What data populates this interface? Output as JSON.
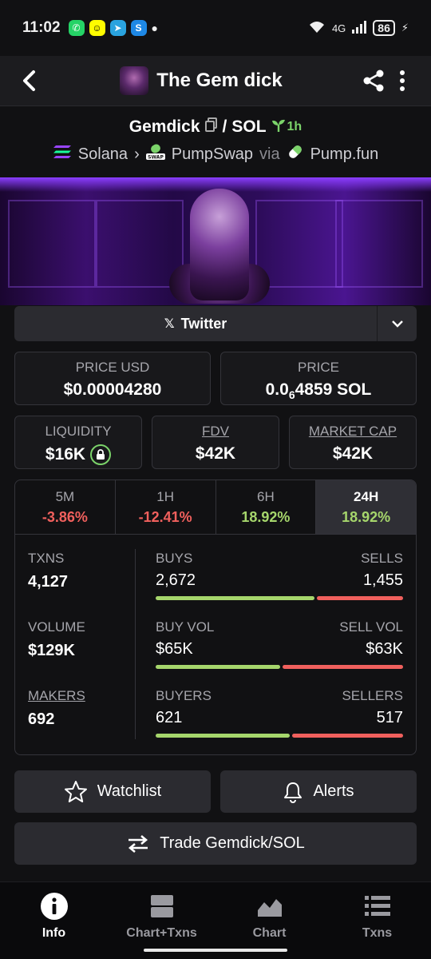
{
  "status_bar": {
    "time": "11:02",
    "network": "4G",
    "battery": "86"
  },
  "header": {
    "title": "The Gem dick"
  },
  "pair": {
    "base": "Gemdick",
    "separator": "/",
    "quote": "SOL",
    "age": "1h",
    "chain": "Solana",
    "dex": "PumpSwap",
    "via": "via",
    "launchpad": "Pump.fun"
  },
  "social": {
    "label": "Twitter"
  },
  "cards": {
    "price_usd": {
      "label": "PRICE USD",
      "value": "$0.00004280"
    },
    "price": {
      "label": "PRICE",
      "value_prefix": "0.0",
      "value_sub": "6",
      "value_suffix": "4859 SOL"
    },
    "liquidity": {
      "label": "LIQUIDITY",
      "value": "$16K"
    },
    "fdv": {
      "label": "FDV",
      "value": "$42K"
    },
    "market_cap": {
      "label": "MARKET CAP",
      "value": "$42K"
    }
  },
  "timeframes": [
    {
      "label": "5M",
      "value": "-3.86%"
    },
    {
      "label": "1H",
      "value": "-12.41%"
    },
    {
      "label": "6H",
      "value": "18.92%"
    },
    {
      "label": "24H",
      "value": "18.92%"
    }
  ],
  "active_timeframe": "24H",
  "stats": {
    "txns": {
      "label": "TXNS",
      "value": "4,127"
    },
    "volume": {
      "label": "VOLUME",
      "value": "$129K"
    },
    "makers": {
      "label": "MAKERS",
      "value": "692"
    },
    "buys": {
      "label": "BUYS",
      "value": "2,672",
      "buy_fraction": 0.647
    },
    "sells": {
      "label": "SELLS",
      "value": "1,455"
    },
    "buy_vol": {
      "label": "BUY VOL",
      "value": "$65K",
      "buy_fraction": 0.508
    },
    "sell_vol": {
      "label": "SELL VOL",
      "value": "$63K"
    },
    "buyers": {
      "label": "BUYERS",
      "value": "621",
      "buy_fraction": 0.546
    },
    "sellers": {
      "label": "SELLERS",
      "value": "517"
    }
  },
  "actions": {
    "watchlist": "Watchlist",
    "alerts": "Alerts",
    "trade": "Trade Gemdick/SOL"
  },
  "nav": [
    {
      "label": "Info",
      "icon": "info-icon"
    },
    {
      "label": "Chart+Txns",
      "icon": "chart-txns-icon"
    },
    {
      "label": "Chart",
      "icon": "chart-icon"
    },
    {
      "label": "Txns",
      "icon": "list-icon"
    }
  ],
  "colors": {
    "positive": "#a6d66c",
    "negative": "#f0605d",
    "background": "#111113"
  }
}
